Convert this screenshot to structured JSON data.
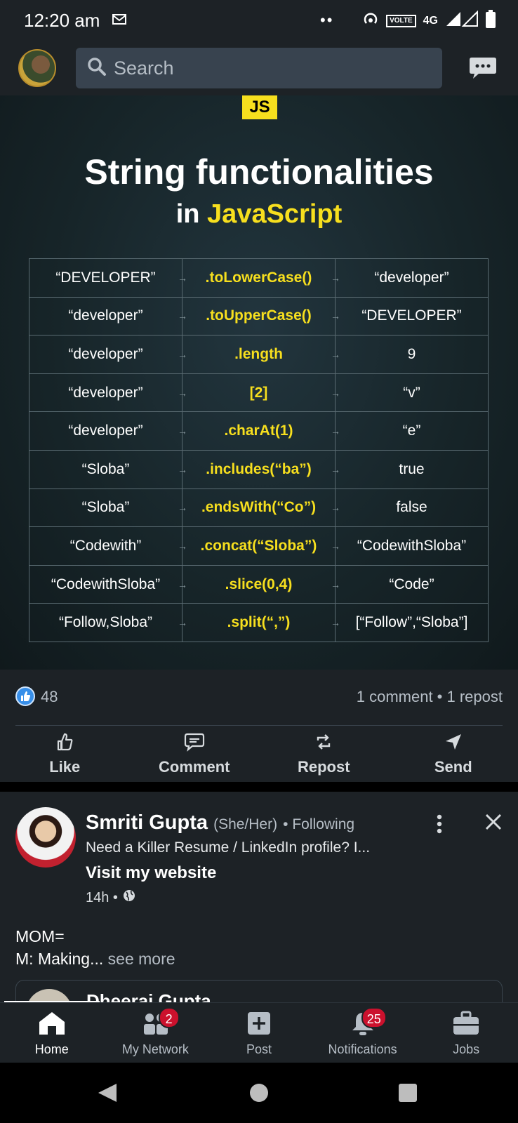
{
  "status_bar": {
    "time": "12:20 am",
    "network": "4G",
    "volte": "VOLTE"
  },
  "header": {
    "search_placeholder": "Search"
  },
  "post_image": {
    "badge": "JS",
    "title": "String functionalities",
    "subtitle_prefix": "in",
    "subtitle_highlight": "JavaScript",
    "rows": [
      {
        "input": "“DEVELOPER”",
        "method": ".toLowerCase()",
        "output": "“developer”"
      },
      {
        "input": "“developer”",
        "method": ".toUpperCase()",
        "output": "“DEVELOPER”"
      },
      {
        "input": "“developer”",
        "method": ".length",
        "output": "9"
      },
      {
        "input": "“developer”",
        "method": "[2]",
        "output": "“v”"
      },
      {
        "input": "“developer”",
        "method": ".charAt(1)",
        "output": "“e”"
      },
      {
        "input": "“Sloba”",
        "method": ".includes(“ba”)",
        "output": "true"
      },
      {
        "input": "“Sloba”",
        "method": ".endsWith(“Co”)",
        "output": "false"
      },
      {
        "input": "“Codewith”",
        "method": ".concat(“Sloba”)",
        "output": "“CodewithSloba”"
      },
      {
        "input": "“CodewithSloba”",
        "method": ".slice(0,4)",
        "output": "“Code”"
      },
      {
        "input": "“Follow,Sloba”",
        "method": ".split(“,”)",
        "output": "[“Follow”,“Sloba”]"
      }
    ]
  },
  "social": {
    "likes": "48",
    "comments_reposts": "1 comment • 1 repost"
  },
  "actions": {
    "like": "Like",
    "comment": "Comment",
    "repost": "Repost",
    "send": "Send"
  },
  "post2": {
    "author": "Smriti Gupta",
    "pronouns": "(She/Her)",
    "following": "• Following",
    "headline": "Need a Killer Resume / LinkedIn profile? I...",
    "visit": "Visit my website",
    "time": "14h •",
    "body_line1": "MOM=",
    "body_line2": "M: Making...",
    "see_more": "see more",
    "embedded_name": "Dheeraj Gupta"
  },
  "bottom_nav": {
    "home": "Home",
    "network": "My Network",
    "network_badge": "2",
    "post": "Post",
    "notifications": "Notifications",
    "notifications_badge": "25",
    "jobs": "Jobs"
  }
}
